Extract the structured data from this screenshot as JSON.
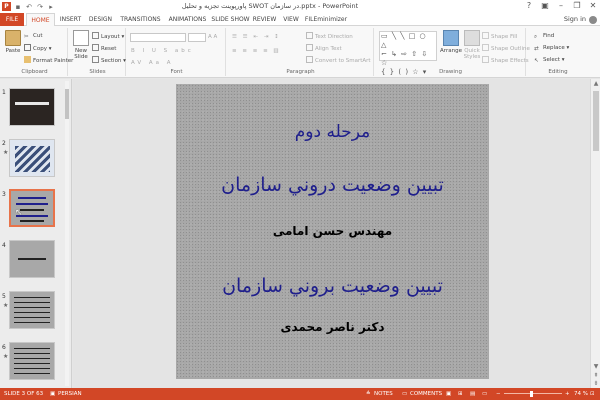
{
  "window": {
    "title": "پاورپوینت تجزیه و تحلیل SWOT در سازمان.pptx - PowerPoint",
    "app_icon": "P",
    "controls": [
      "?",
      "▣",
      "–",
      "❐",
      "✕"
    ]
  },
  "tabs": [
    "FILE",
    "HOME",
    "INSERT",
    "DESIGN",
    "TRANSITIONS",
    "ANIMATIONS",
    "SLIDE SHOW",
    "REVIEW",
    "VIEW",
    "FILEminimizer"
  ],
  "active_tab": "HOME",
  "account": {
    "sign_in": "Sign in"
  },
  "ribbon": {
    "clipboard": {
      "label": "Clipboard",
      "paste": "Paste",
      "cut": "Cut",
      "copy": "Copy",
      "format_painter": "Format Painter"
    },
    "slides": {
      "label": "Slides",
      "new_slide": "New",
      "new_slide_2": "Slide",
      "layout": "Layout",
      "reset": "Reset",
      "section": "Section"
    },
    "font": {
      "label": "Font"
    },
    "paragraph": {
      "label": "Paragraph",
      "text_direction": "Text Direction",
      "align_text": "Align Text",
      "convert_smartart": "Convert to SmartArt"
    },
    "drawing": {
      "label": "Drawing",
      "arrange": "Arrange",
      "quick_styles": "Quick",
      "quick_styles_2": "Styles",
      "shape_fill": "Shape Fill",
      "shape_outline": "Shape Outline",
      "shape_effects": "Shape Effects"
    },
    "editing": {
      "label": "Editing",
      "find": "Find",
      "replace": "Replace",
      "select": "Select"
    }
  },
  "thumbnails": [
    {
      "num": "1",
      "star": ""
    },
    {
      "num": "2",
      "star": "★"
    },
    {
      "num": "3",
      "star": ""
    },
    {
      "num": "4",
      "star": ""
    },
    {
      "num": "5",
      "star": "★"
    },
    {
      "num": "6",
      "star": "★"
    }
  ],
  "slide": {
    "line1": "مرحله دوم",
    "line2": "تبيين وضعيت دروني سازمان",
    "line3": "مهندس حسن امامی",
    "line4": "تبيين وضعيت بروني سازمان",
    "line5": "دکتر ناصر محمدی"
  },
  "status": {
    "slide_of": "SLIDE 3 OF 63",
    "language": "PERSIAN",
    "notes": "NOTES",
    "comments": "COMMENTS",
    "zoom": "74 %"
  },
  "colors": {
    "accent": "#d24726",
    "slide_title": "#1f1f8c"
  }
}
